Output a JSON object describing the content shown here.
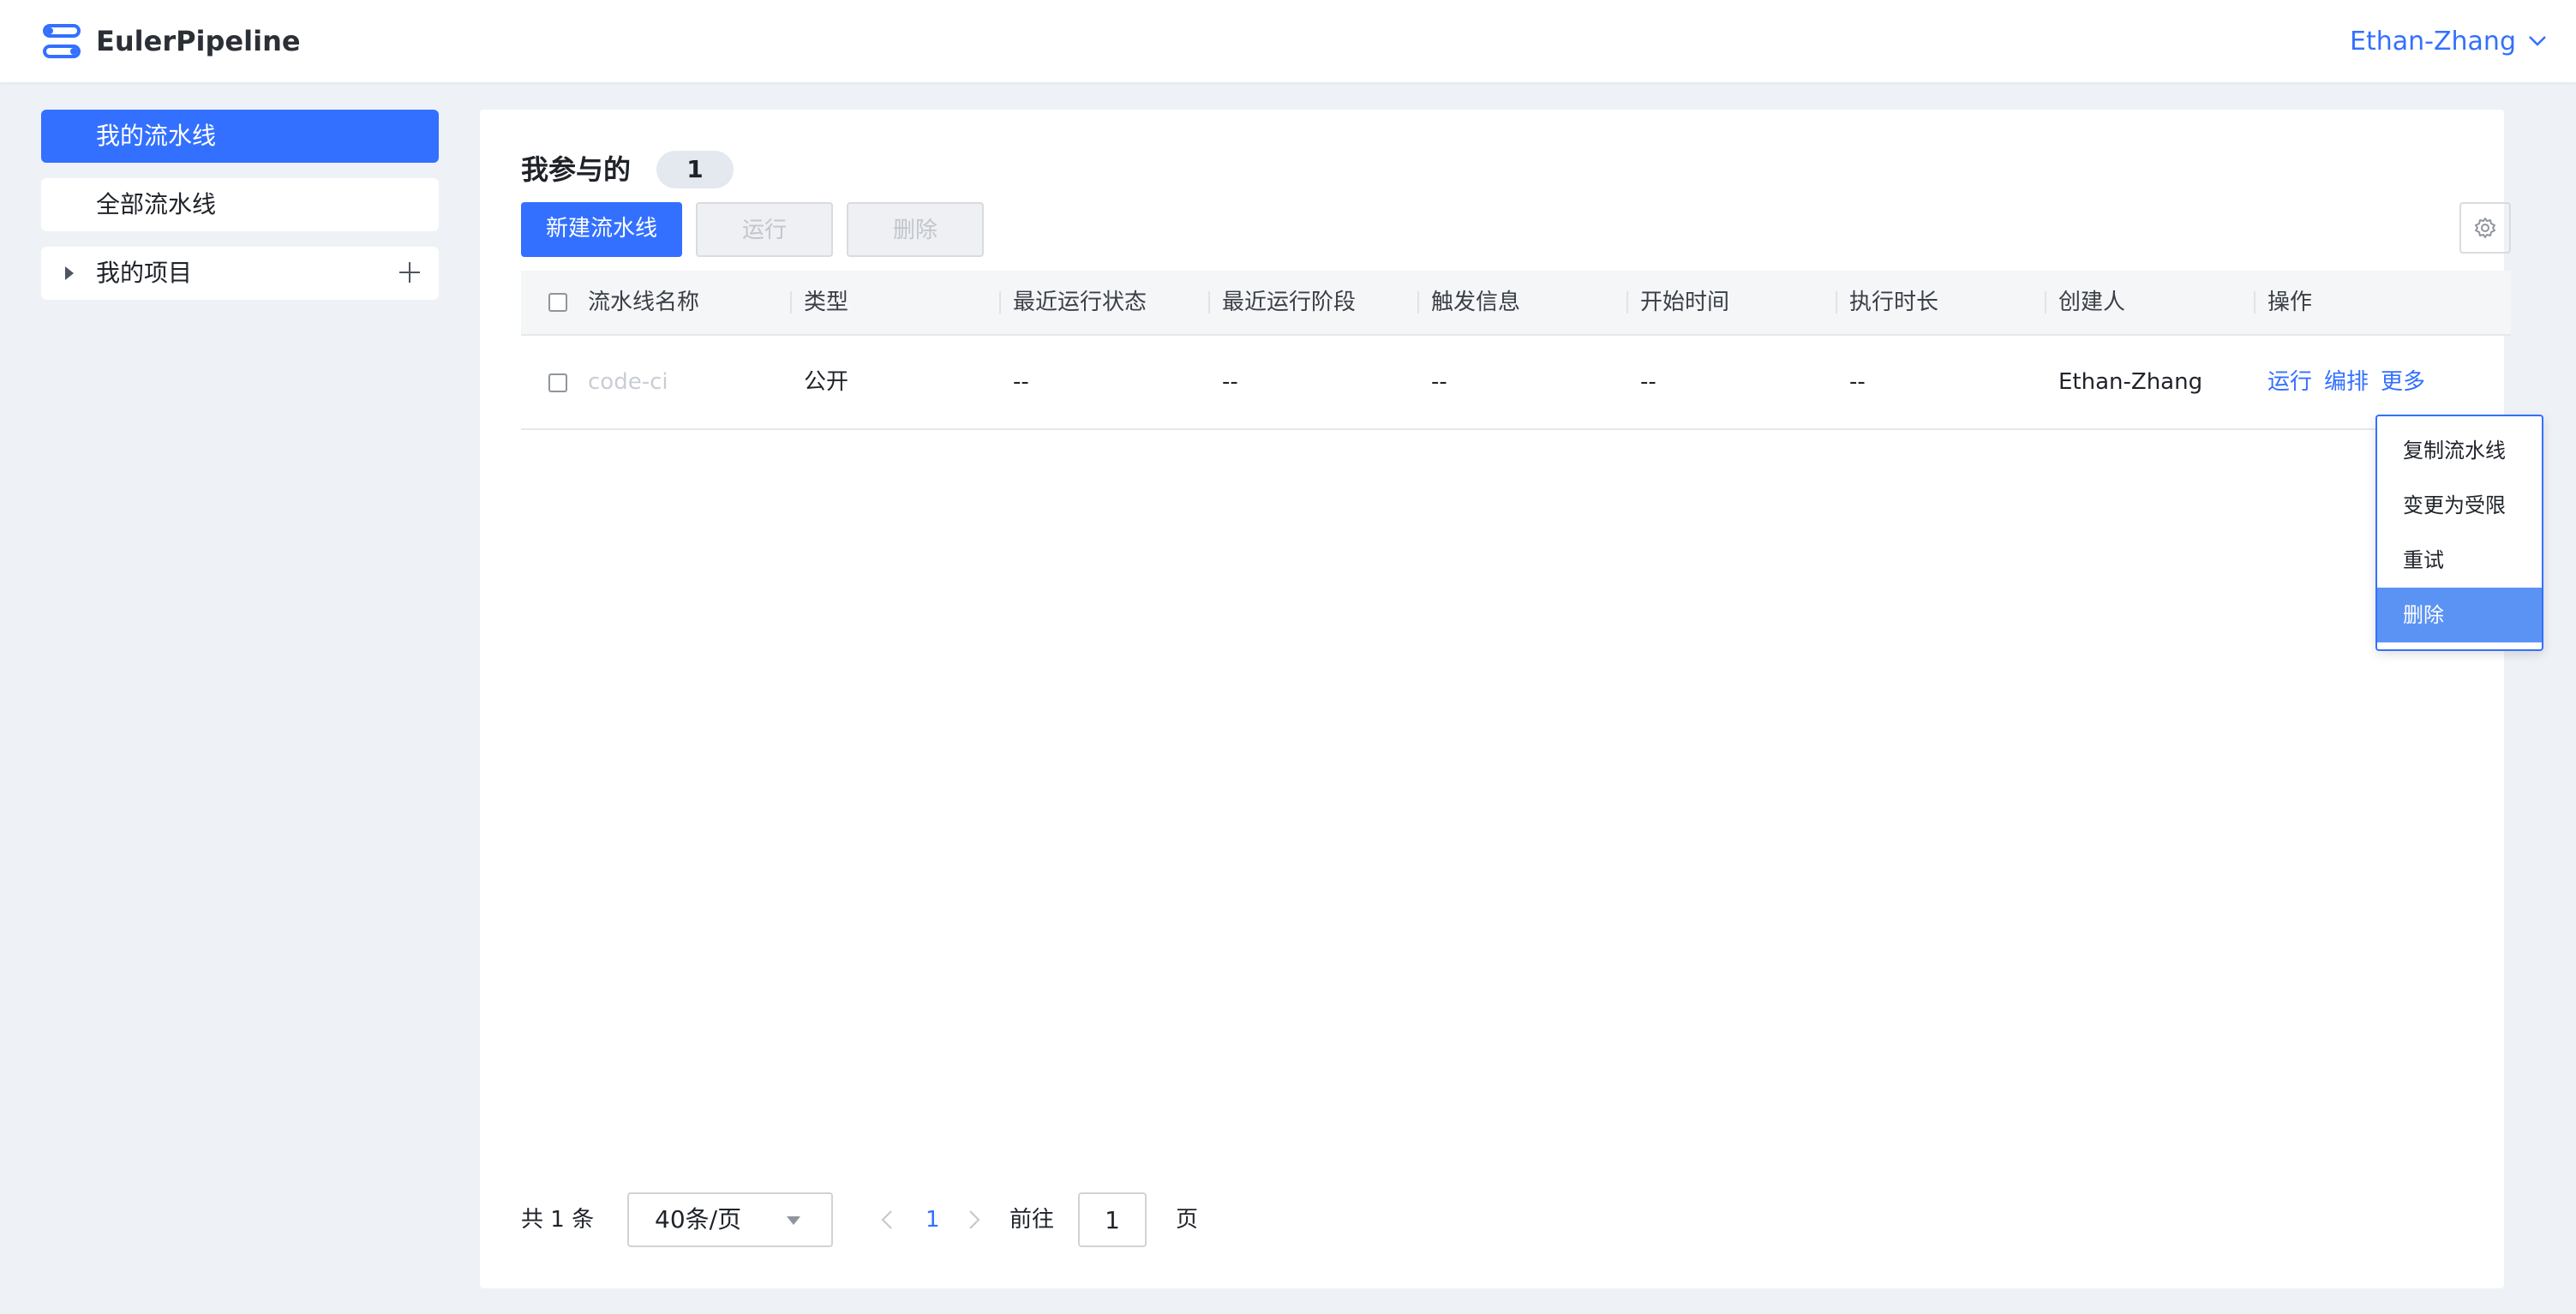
{
  "app": {
    "name": "EulerPipeline",
    "logo_icon": "pipeline-logo-icon",
    "accent": "#3370ff"
  },
  "header": {
    "user_name": "Ethan-Zhang"
  },
  "sidebar": {
    "items": [
      {
        "label": "我的流水线",
        "active": true
      },
      {
        "label": "全部流水线",
        "active": false
      },
      {
        "label": "我的项目",
        "active": false
      }
    ]
  },
  "main": {
    "title": "我参与的",
    "count": "1",
    "toolbar": {
      "new_label": "新建流水线",
      "run_label": "运行",
      "delete_label": "删除"
    },
    "table": {
      "columns": [
        "流水线名称",
        "类型",
        "最近运行状态",
        "最近运行阶段",
        "触发信息",
        "开始时间",
        "执行时长",
        "创建人",
        "操作"
      ],
      "rows": [
        {
          "name": "code-ci",
          "type": "公开",
          "last_status": "--",
          "last_stage": "--",
          "trigger": "--",
          "start_time": "--",
          "duration": "--",
          "creator": "Ethan-Zhang",
          "actions": [
            "运行",
            "编排",
            "更多"
          ]
        }
      ]
    },
    "more_menu": {
      "items": [
        "复制流水线",
        "变更为受限",
        "重试",
        "删除"
      ],
      "highlighted": "删除"
    },
    "pagination": {
      "total": "共 1 条",
      "page_size": "40条/页",
      "current": "1",
      "goto_label": "前往",
      "goto_value": "1",
      "page_suffix": "页"
    }
  }
}
